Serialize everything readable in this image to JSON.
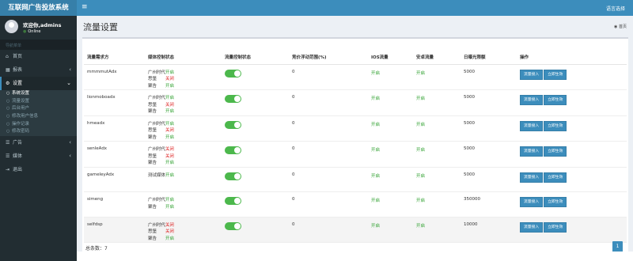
{
  "app": {
    "title": "互联网广告投放系统",
    "toggle_icon": "≡",
    "language": "语言选择"
  },
  "user": {
    "name": "欢迎你,admins",
    "status": "Online"
  },
  "sidebar": {
    "nav_header": "导航菜单",
    "items": [
      {
        "label": "首页",
        "icon": "home-icon"
      },
      {
        "label": "报表",
        "icon": "table-icon"
      },
      {
        "label": "设置",
        "icon": "gears-icon"
      },
      {
        "label": "广告",
        "icon": "list-icon"
      },
      {
        "label": "媒体",
        "icon": "list-icon"
      },
      {
        "label": "退出",
        "icon": "sign-out-icon"
      }
    ],
    "submenu": [
      "系统设置",
      "流量设置",
      "后台用户",
      "修改用户信息",
      "操作记录",
      "修改密码"
    ]
  },
  "page": {
    "title": "流量设置",
    "breadcrumb": "首页"
  },
  "table": {
    "headers": [
      "流量需求方",
      "媒体控制状态",
      "流量控制状态",
      "竞价浮动范围(%)",
      "IOS流量",
      "安卓流量",
      "日曝光限额",
      "操作"
    ],
    "rows": [
      {
        "name": "mmmmutAdx",
        "media": [
          [
            "广州时代",
            "开启",
            "on"
          ],
          [
            "思堡",
            "关闭",
            "off"
          ],
          [
            "聚告",
            "开启",
            "on"
          ]
        ],
        "range": "0",
        "ios": "开启",
        "android": "开启",
        "limit": "5000"
      },
      {
        "name": "lionmoboadx",
        "media": [
          [
            "广州时代",
            "开启",
            "on"
          ],
          [
            "思堡",
            "关闭",
            "off"
          ],
          [
            "聚告",
            "开启",
            "on"
          ]
        ],
        "range": "0",
        "ios": "开启",
        "android": "开启",
        "limit": "5000"
      },
      {
        "name": "hmeadx",
        "media": [
          [
            "广州时代",
            "开启",
            "on"
          ],
          [
            "思堡",
            "关闭",
            "off"
          ],
          [
            "聚告",
            "开启",
            "on"
          ]
        ],
        "range": "0",
        "ios": "开启",
        "android": "开启",
        "limit": "5000"
      },
      {
        "name": "senleAdx",
        "media": [
          [
            "广州时代",
            "关闭",
            "off"
          ],
          [
            "思堡",
            "关闭",
            "off"
          ],
          [
            "聚告",
            "开启",
            "on"
          ]
        ],
        "range": "0",
        "ios": "开启",
        "android": "开启",
        "limit": "5000"
      },
      {
        "name": "gameleyAdx",
        "media": [
          [
            "测试媒体",
            "开启",
            "on"
          ]
        ],
        "range": "0",
        "ios": "开启",
        "android": "开启",
        "limit": "5000"
      },
      {
        "name": "simeng",
        "media": [
          [
            "广州时代",
            "开启",
            "on"
          ],
          [
            "聚告",
            "开启",
            "on"
          ]
        ],
        "range": "0",
        "ios": "开启",
        "android": "开启",
        "limit": "350000"
      },
      {
        "name": "selfdsp",
        "media": [
          [
            "广州时代",
            "关闭",
            "off"
          ],
          [
            "思堡",
            "关闭",
            "off"
          ],
          [
            "聚告",
            "开启",
            "on"
          ]
        ],
        "range": "0",
        "ios": "开启",
        "android": "开启",
        "limit": "10000"
      }
    ],
    "btn_access": "流量接入",
    "btn_apply": "立即生效"
  },
  "footer": {
    "total": "总条数：7",
    "page": "1"
  },
  "colors": {
    "header": "#3c8dbc",
    "sidebar": "#222d32",
    "on": "#2ea02e",
    "off": "#dd2020"
  }
}
